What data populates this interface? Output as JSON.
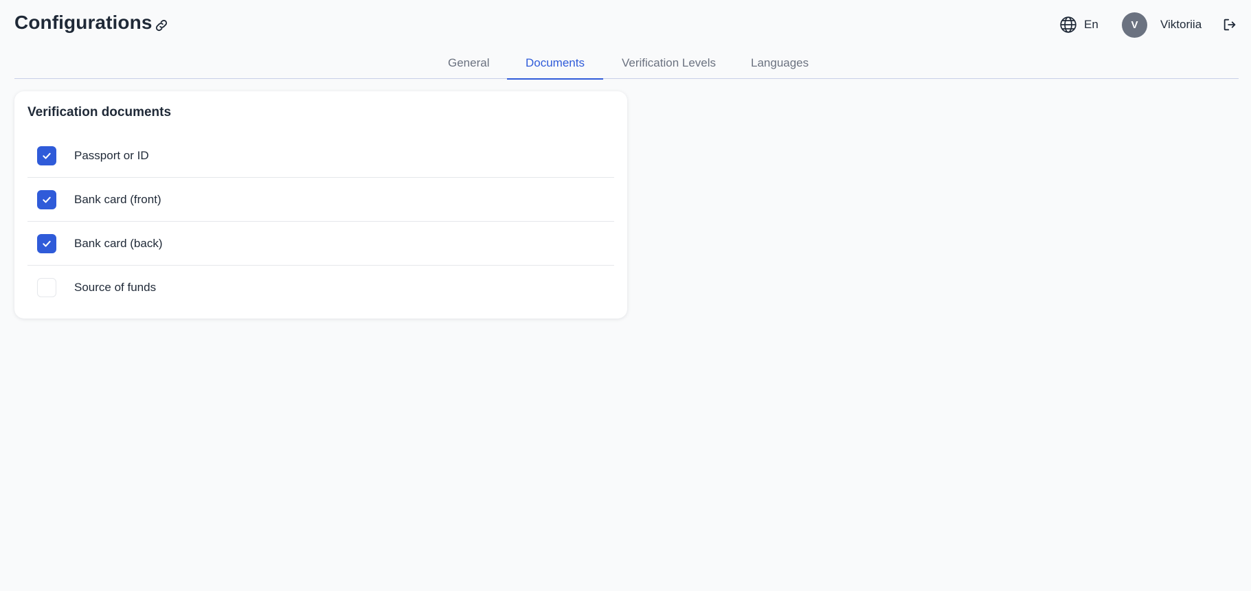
{
  "header": {
    "title": "Configurations",
    "language": "En",
    "user": {
      "initial": "V",
      "name": "Viktoriia"
    }
  },
  "tabs": [
    {
      "label": "General",
      "active": false
    },
    {
      "label": "Documents",
      "active": true
    },
    {
      "label": "Verification Levels",
      "active": false
    },
    {
      "label": "Languages",
      "active": false
    }
  ],
  "documents": {
    "title": "Verification documents",
    "items": [
      {
        "label": "Passport or ID",
        "checked": true
      },
      {
        "label": "Bank card (front)",
        "checked": true
      },
      {
        "label": "Bank card (back)",
        "checked": true
      },
      {
        "label": "Source of funds",
        "checked": false
      }
    ]
  },
  "colors": {
    "accent": "#2f5bd9",
    "background": "#f9fafb",
    "avatar": "#6b7280"
  },
  "icons": {
    "link": "link-icon",
    "language": "globe-icon",
    "logout": "logout-icon",
    "check": "check-icon"
  }
}
